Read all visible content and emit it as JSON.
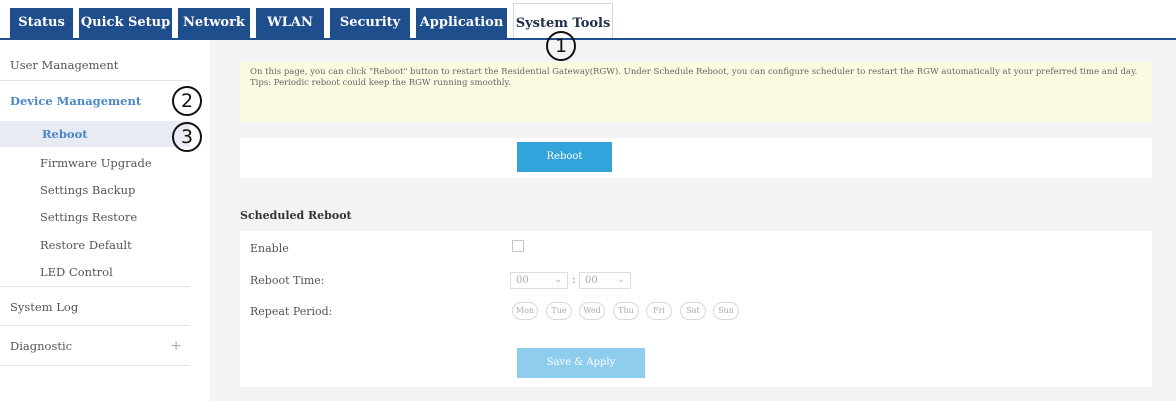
{
  "topnav": {
    "tabs": [
      {
        "label": "Status"
      },
      {
        "label": "Quick Setup"
      },
      {
        "label": "Network"
      },
      {
        "label": "WLAN"
      },
      {
        "label": "Security"
      },
      {
        "label": "Application"
      },
      {
        "label": "System Tools"
      }
    ]
  },
  "sidebar": {
    "user_management": "User Management",
    "device_management": "Device Management",
    "reboot": "Reboot",
    "firmware_upgrade": "Firmware Upgrade",
    "settings_backup": "Settings Backup",
    "settings_restore": "Settings Restore",
    "restore_default": "Restore Default",
    "led_control": "LED Control",
    "system_log": "System Log",
    "diagnostic": "Diagnostic",
    "diagnostic_expand": "+"
  },
  "info": {
    "line1": "On this page, you can click \"Reboot\" button to restart the Residential Gateway(RGW). Under Schedule Reboot, you can configure scheduler to restart the RGW automatically at your preferred time and day.",
    "line2": "Tips: Periodic reboot could keep the RGW running smoothly."
  },
  "reboot_button": "Reboot",
  "scheduled": {
    "title": "Scheduled Reboot",
    "enable_label": "Enable",
    "enable_checked": false,
    "reboot_time_label": "Reboot Time:",
    "hour": "00",
    "minute": "00",
    "colon": ":",
    "repeat_label": "Repeat Period:",
    "days": [
      "Mon",
      "Tue",
      "Wed",
      "Thu",
      "Fri",
      "Sat",
      "Sun"
    ],
    "save_button": "Save & Apply"
  },
  "annotations": {
    "step1": "1",
    "step2": "2",
    "step3": "3"
  },
  "colors": {
    "nav_blue": "#1f4e8c",
    "accent_blue": "#33a3dc",
    "link_blue": "#4a86c8",
    "info_yellow": "#fcfae1"
  }
}
